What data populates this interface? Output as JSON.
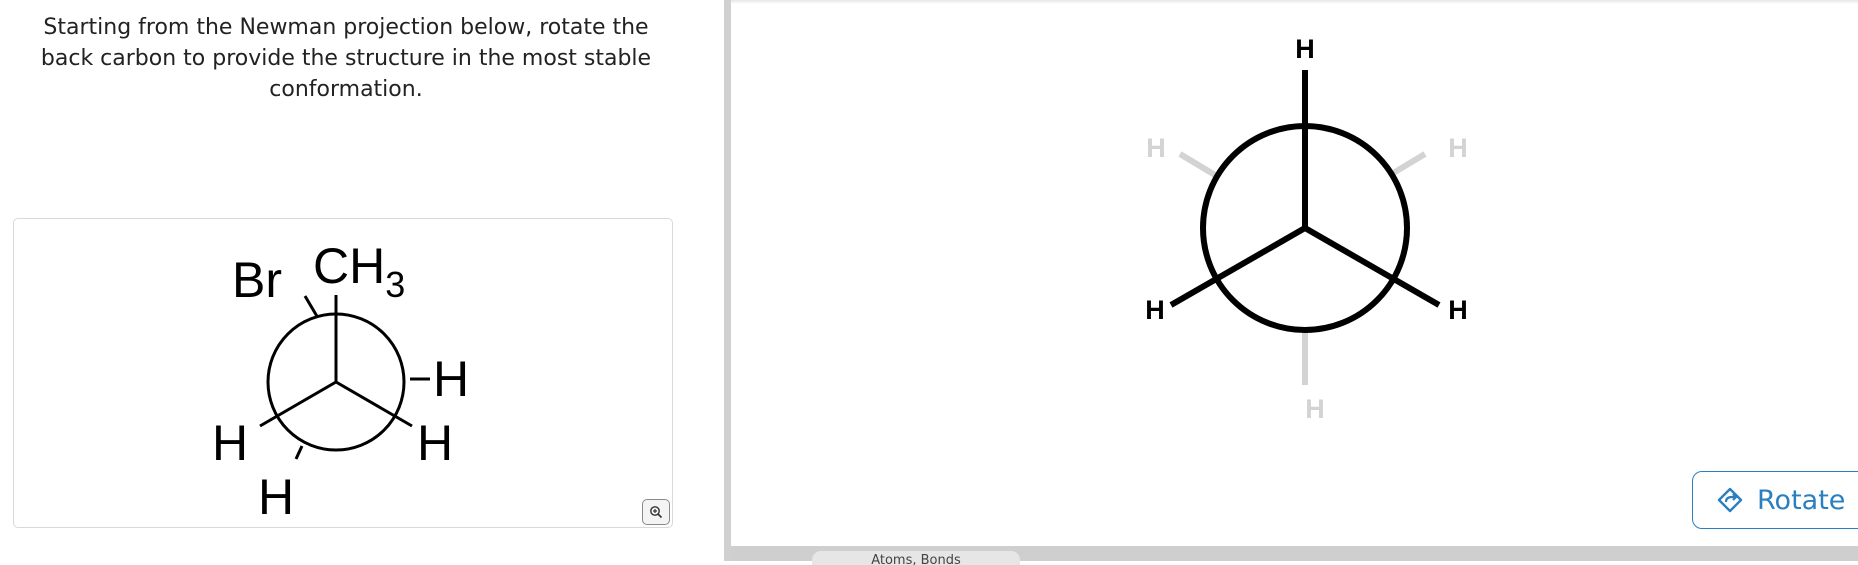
{
  "question": {
    "text": "Starting from the Newman projection below, rotate the back carbon to provide the structure in the most stable conformation."
  },
  "given_projection": {
    "front_substituents": [
      "CH3",
      "H",
      "H"
    ],
    "back_substituents": [
      "Br",
      "H",
      "H"
    ],
    "labels": {
      "br": "Br",
      "ch3_main": "CH",
      "ch3_sub": "3",
      "h_right_upper": "H",
      "h_right_lower": "H",
      "h_left": "H",
      "h_bottom": "H"
    }
  },
  "editor": {
    "labels": {
      "front_top": "H",
      "front_left": "H",
      "front_right": "H",
      "back_upper_left": "H",
      "back_upper_right": "H",
      "back_bottom": "H"
    },
    "rotate_label": "Rotate",
    "bottom_tab_label": "Atoms, Bonds"
  },
  "colors": {
    "accent": "#2a7fc0",
    "ghost": "#d3d3d3",
    "ink": "#000000"
  },
  "icons": {
    "zoom": "zoom-in-icon",
    "rotate": "rotate-icon"
  }
}
